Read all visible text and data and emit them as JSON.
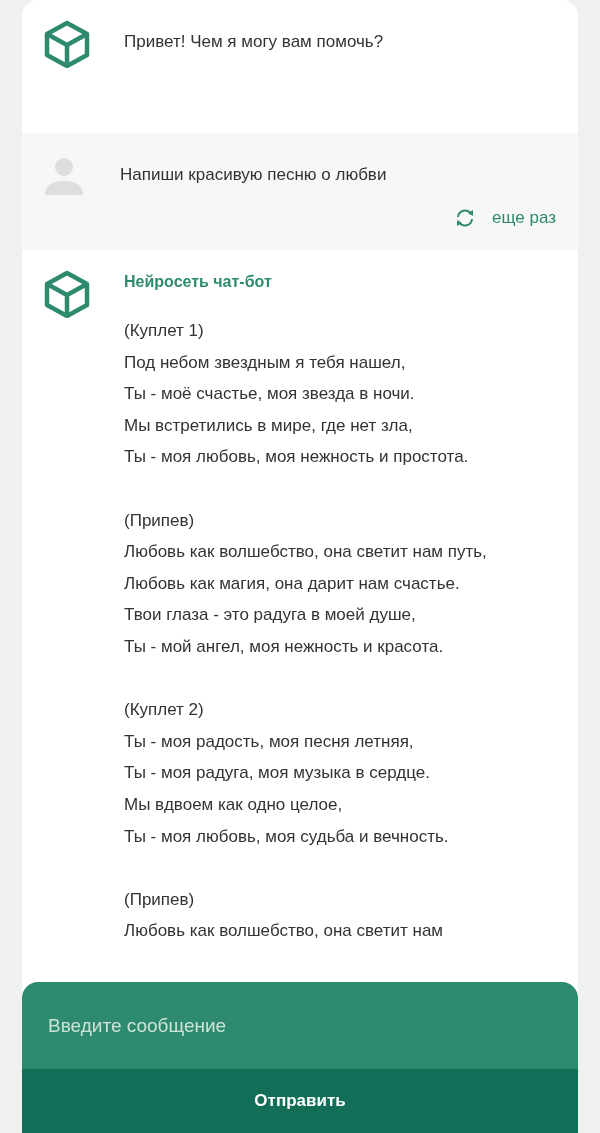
{
  "messages": [
    {
      "kind": "bot",
      "text": "Привет! Чем я могу вам помочь?"
    },
    {
      "kind": "user",
      "text": "Напиши красивую песню о любви",
      "action": "еще раз"
    },
    {
      "kind": "bot",
      "author": "Нейросеть чат-бот",
      "stanzas": [
        [
          "(Куплет 1)",
          "Под небом звездным я тебя нашел,",
          "Ты - моё счастье, моя звезда в ночи.",
          "Мы встретились в мире, где нет зла,",
          "Ты - моя любовь, моя нежность и простота."
        ],
        [
          "(Припев)",
          "Любовь как волшебство, она светит нам путь,",
          "Любовь как магия, она дарит нам счастье.",
          "Твои глаза - это радуга в моей душе,",
          "Ты - мой ангел, моя нежность и красота."
        ],
        [
          "(Куплет 2)",
          "Ты - моя радость, моя песня летняя,",
          "Ты - моя радуга, моя музыка в сердце.",
          "Мы вдвоем как одно целое,",
          "Ты - моя любовь, моя судьба и вечность."
        ],
        [
          "(Припев)",
          "Любовь как волшебство, она светит нам"
        ]
      ]
    }
  ],
  "composer": {
    "placeholder": "Введите сообщение",
    "send": "Отправить"
  }
}
